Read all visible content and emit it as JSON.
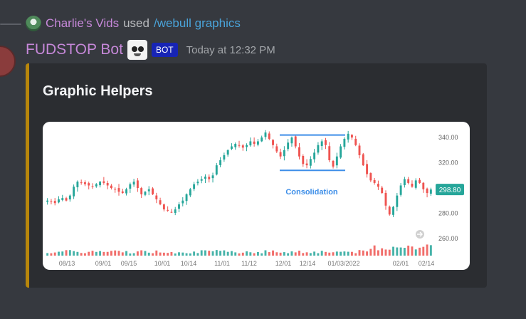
{
  "reply": {
    "user": "Charlie's Vids",
    "verb": "used",
    "command": "/webull graphics"
  },
  "message": {
    "bot_name": "FUDSTOP Bot",
    "bot_tag": "BOT",
    "timestamp": "Today at 12:32 PM"
  },
  "embed": {
    "title": "Graphic Helpers",
    "accent_color": "#b8860b"
  },
  "icons": {
    "reply_avatar": "user-avatar-icon",
    "bot_avatar": "bot-avatar-icon",
    "chart_badge": "arrow-right-icon"
  },
  "chart_data": {
    "type": "candlestick",
    "title": "",
    "xlabel": "",
    "ylabel": "",
    "ylim": [
      252,
      348
    ],
    "y_ticks": [
      "340.00",
      "320.00",
      "300.00",
      "280.00",
      "260.00"
    ],
    "y_tick_values": [
      340,
      320,
      300,
      280,
      260
    ],
    "x_ticks": [
      "08/13",
      "09/01",
      "09/15",
      "10/01",
      "10/14",
      "11/01",
      "11/12",
      "12/01",
      "12/14",
      "01/03/2022",
      "02/01",
      "02/14"
    ],
    "last_price": "298.80",
    "last_price_value": 298.8,
    "annotation": {
      "label": "Consolidation",
      "upper": 342,
      "lower": 314
    },
    "close_path": [
      290,
      289,
      288,
      291,
      292,
      290,
      294,
      301,
      305,
      304,
      303,
      302,
      301,
      303,
      305,
      304,
      302,
      300,
      299,
      297,
      296,
      299,
      303,
      305,
      300,
      295,
      297,
      299,
      295,
      291,
      287,
      283,
      282,
      281,
      283,
      287,
      290,
      295,
      299,
      303,
      305,
      307,
      309,
      307,
      310,
      318,
      322,
      326,
      330,
      333,
      335,
      334,
      332,
      334,
      337,
      335,
      337,
      340,
      344,
      339,
      334,
      329,
      325,
      330,
      336,
      340,
      333,
      325,
      319,
      318,
      323,
      328,
      334,
      337,
      334,
      322,
      317,
      325,
      333,
      339,
      343,
      340,
      334,
      326,
      318,
      311,
      306,
      304,
      301,
      296,
      286,
      279,
      285,
      294,
      302,
      307,
      304,
      301,
      306,
      304,
      299,
      296,
      298.8
    ],
    "colors": {
      "up": "#26a69a",
      "down": "#ef5350",
      "annotation": "#3d8ee8",
      "price_badge": "#26a69a"
    }
  }
}
